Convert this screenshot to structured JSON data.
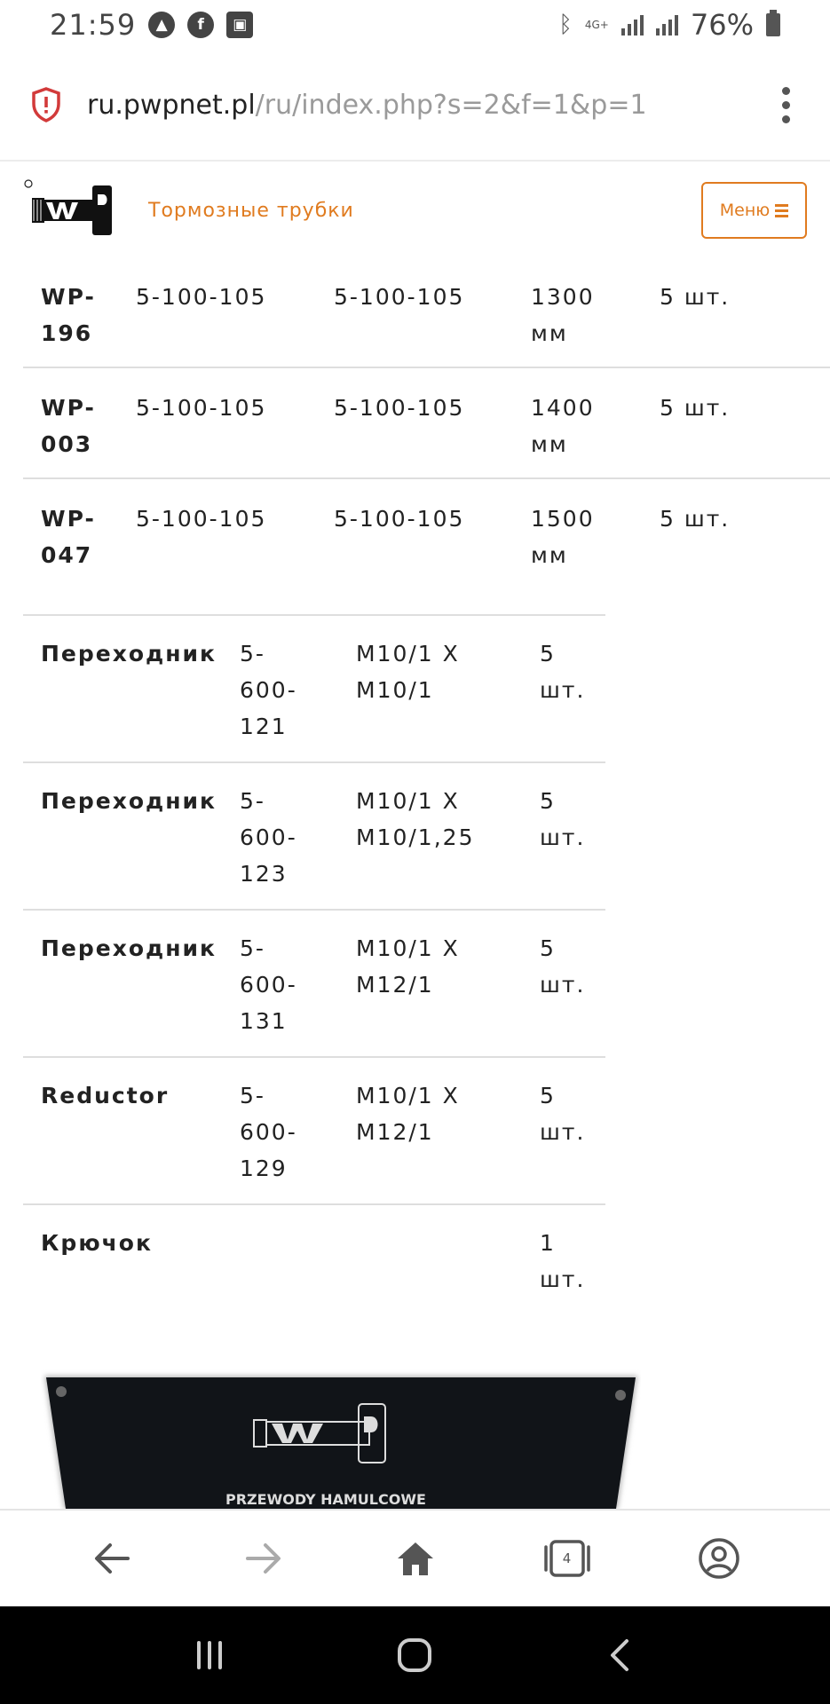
{
  "status": {
    "time": "21:59",
    "network": "4G+",
    "battery": "76%",
    "icons": [
      "maps-icon",
      "facebook-icon",
      "gallery-icon",
      "bluetooth-icon",
      "signal-icon",
      "battery-icon"
    ]
  },
  "browser": {
    "url_host": "ru.pwpnet.pl",
    "url_path": "/ru/index.php?s=2&f=1&p=1",
    "tab_count": "4"
  },
  "site": {
    "title": "Тормозные трубки",
    "menu_label": "Меню",
    "photo_caption": "PRZEWODY HAMULCOWE"
  },
  "table1": {
    "rows": [
      {
        "code": "WP-\n196",
        "part1": "5-100-105",
        "part2": "5-100-105",
        "length": "1300\nмм",
        "qty": "5 шт."
      },
      {
        "code": "WP-\n003",
        "part1": "5-100-105",
        "part2": "5-100-105",
        "length": "1400\nмм",
        "qty": "5 шт."
      },
      {
        "code": "WP-\n047",
        "part1": "5-100-105",
        "part2": "5-100-105",
        "length": "1500\nмм",
        "qty": "5 шт."
      }
    ]
  },
  "table2": {
    "rows": [
      {
        "name": "Переходник",
        "code": "5-\n600-\n121",
        "thread": "M10/1 X\nM10/1",
        "qty": "5\nшт."
      },
      {
        "name": "Переходник",
        "code": "5-\n600-\n123",
        "thread": "M10/1 X\nM10/1,25",
        "qty": "5\nшт."
      },
      {
        "name": "Переходник",
        "code": "5-\n600-\n131",
        "thread": "M10/1 X\nM12/1",
        "qty": "5\nшт."
      },
      {
        "name": "Reductor",
        "code": "5-\n600-\n129",
        "thread": "M10/1 X\nM12/1",
        "qty": "5\nшт."
      },
      {
        "name": "Крючок",
        "code": "",
        "thread": "",
        "qty": "1\nшт."
      }
    ]
  },
  "colors": {
    "accent": "#e07b1f",
    "divider": "#dedede",
    "text": "#222222",
    "url_path": "#9a9a9a"
  }
}
